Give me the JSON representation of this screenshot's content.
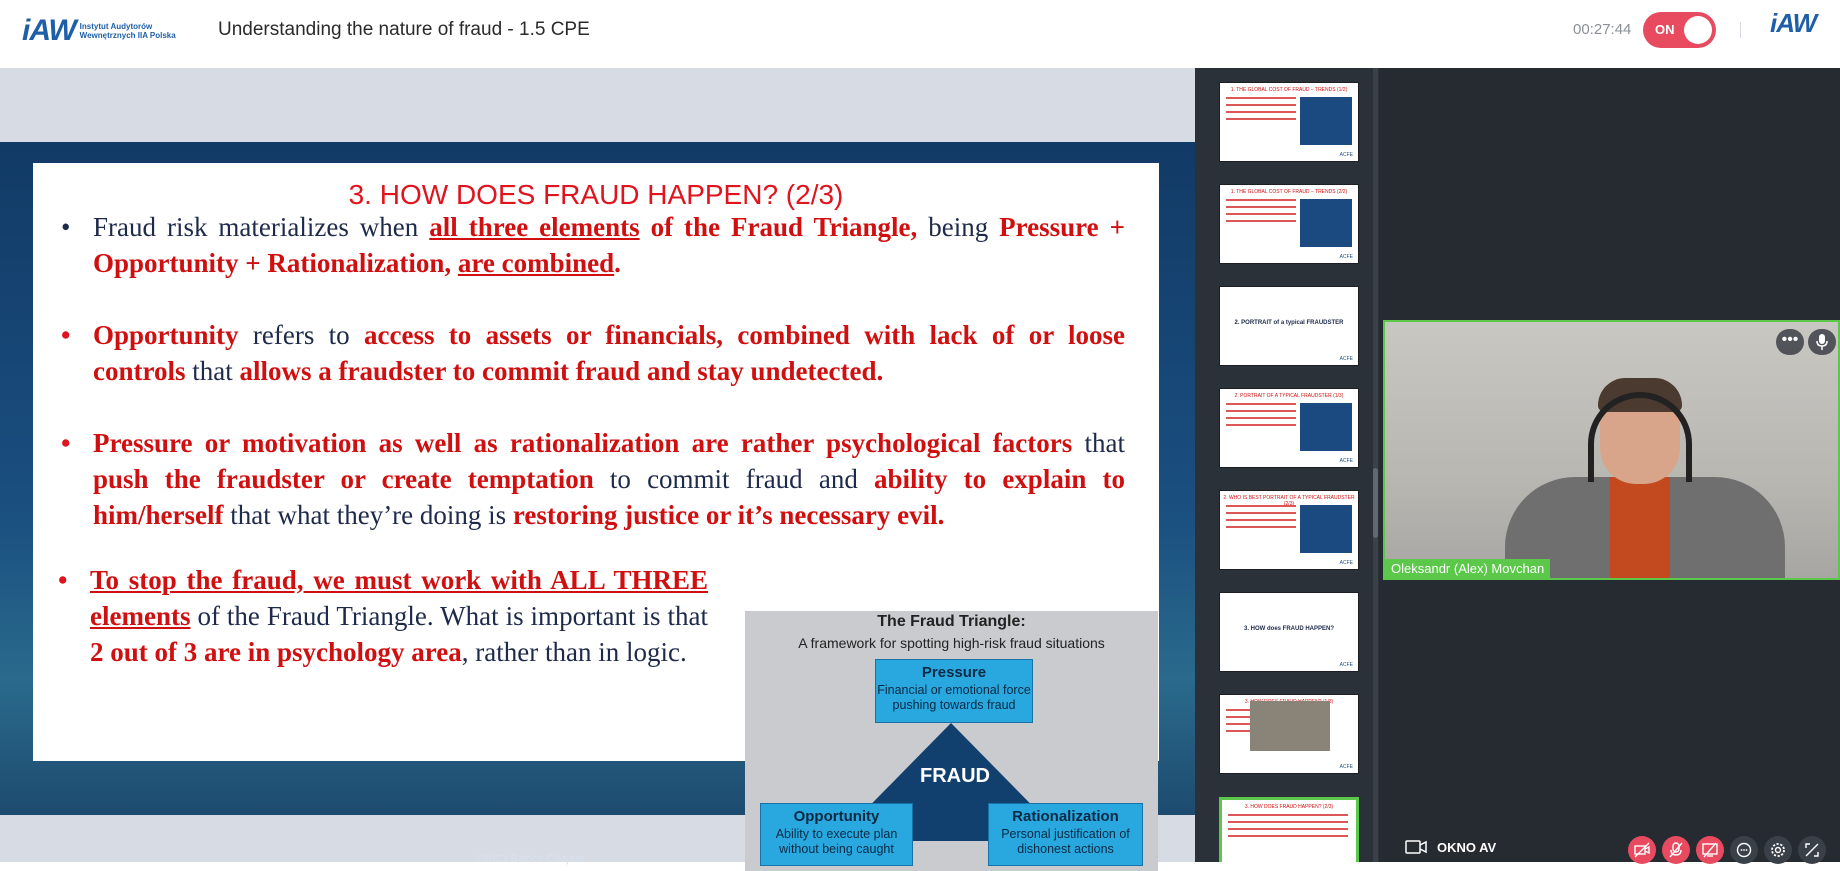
{
  "header": {
    "logo_mark": "iAW",
    "logo_line1": "Instytut Audytorów",
    "logo_line2": "Wewnętrznych IIA Polska",
    "title": "Understanding the nature of fraud - 1.5 CPE",
    "timer": "00:27:44",
    "record_toggle": "ON",
    "small_logo_mark": "iAW"
  },
  "slide": {
    "title": "3. HOW DOES FRAUD HAPPEN? (2/3)",
    "b1": {
      "p1": "Fraud risk materializes when ",
      "p2": "all three elements",
      "p3": " of the Fraud Triangle,",
      "p4": " being ",
      "p5": "Pressure + Opportunity + Rationalization, ",
      "p6": "are combined",
      "p7": "."
    },
    "b2": {
      "p1": "Opportunity",
      "p2": " refers to ",
      "p3": "access to assets or financials, combined with lack of or loose controls",
      "p4": " that ",
      "p5": "allows a fraudster to commit fraud and stay undetected."
    },
    "b3": {
      "p1": "Pressure or motivation as well as rationalization are rather psychological factors",
      "p2": " that ",
      "p3": "push the fraudster or create temptation",
      "p4": " to commit fraud and ",
      "p5": "ability to explain to him/herself",
      "p6": " that what they’re doing is ",
      "p7": "restoring justice or it’s necessary evil."
    },
    "b4": {
      "p1": "To stop the fraud, we must work with ALL THREE elements",
      "p2": " of the Fraud Triangle. What is important is that ",
      "p3": "2 out of 3 are in psychology area",
      "p4": ", rather than in logic."
    },
    "copyright": "©2023 Baltics Chapter",
    "triangle": {
      "title": "The Fraud Triangle:",
      "subtitle": "A framework for spotting high-risk fraud situations",
      "center": "FRAUD",
      "pressure_title": "Pressure",
      "pressure_desc": "Financial or emotional force pushing towards fraud",
      "opportunity_title": "Opportunity",
      "opportunity_desc": "Ability to execute plan without being caught",
      "rationalization_title": "Rationalization",
      "rationalization_desc": "Personal justification of dishonest actions"
    }
  },
  "thumbnails": [
    {
      "title": "1. THE GLOBAL COST OF FRAUD – TRENDS (1/2)",
      "type": "chart"
    },
    {
      "title": "1. THE GLOBAL COST OF FRAUD – TRENDS (2/2)",
      "type": "chart"
    },
    {
      "title": "2. PORTRAIT of a typical FRAUDSTER",
      "type": "section"
    },
    {
      "title": "2. PORTRAIT OF A TYPICAL FRAUDSTER (1/3)",
      "type": "chart"
    },
    {
      "title": "2. WHO IS BEST PORTRAIT OF A TYPICAL FRAUDSTER (2/3)",
      "type": "chart"
    },
    {
      "title": "3. HOW does FRAUD HAPPEN?",
      "type": "section"
    },
    {
      "title": "3. HOW DOES FRAUD HAPPEN? (1/3)",
      "type": "photo"
    },
    {
      "title": "3. HOW DOES FRAUD HAPPEN? (2/3)",
      "type": "text",
      "active": true
    }
  ],
  "thumb_footer": "ACFE",
  "video": {
    "participant_name": "Oleksandr (Alex) Movchan",
    "more_label": "•••"
  },
  "controls": {
    "window_label": "OKNO AV"
  },
  "colors": {
    "accent_red": "#e84a5f",
    "slide_red": "#d01010",
    "active_green": "#5cc84a",
    "sidebar_bg": "#2b3138"
  }
}
